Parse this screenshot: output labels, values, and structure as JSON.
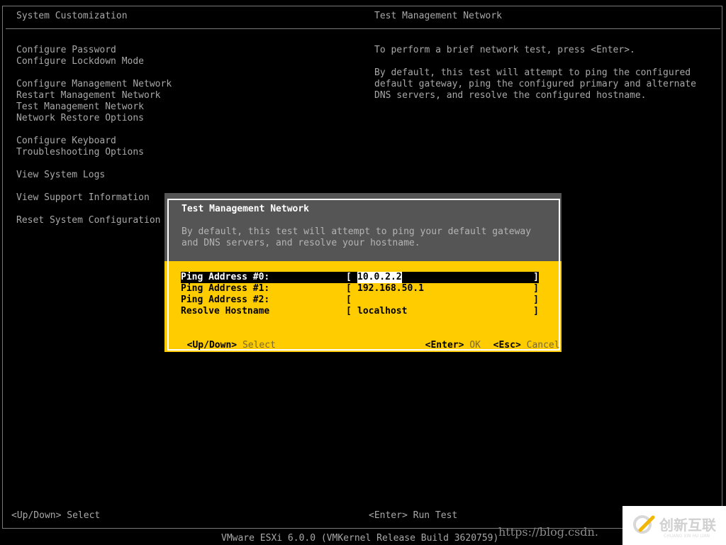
{
  "left_panel": {
    "title": "System Customization",
    "menu_groups": [
      [
        "Configure Password",
        "Configure Lockdown Mode"
      ],
      [
        "Configure Management Network",
        "Restart Management Network",
        "Test Management Network",
        "Network Restore Options"
      ],
      [
        "Configure Keyboard",
        "Troubleshooting Options"
      ],
      [
        "View System Logs"
      ],
      [
        "View Support Information"
      ],
      [
        "Reset System Configuration"
      ]
    ]
  },
  "right_panel": {
    "title": "Test Management Network",
    "lines": [
      "To perform a brief network test, press <Enter>.",
      "",
      "By default, this test will attempt to ping the configured",
      "default gateway, ping the configured primary and alternate",
      "DNS servers, and resolve the configured hostname."
    ]
  },
  "dialog": {
    "title": "Test Management Network",
    "description": [
      "By default, this test will attempt to ping your default gateway",
      "and DNS servers, and resolve your hostname."
    ],
    "fields": [
      {
        "label": "Ping Address #0:",
        "value": "10.0.2.2",
        "selected": true
      },
      {
        "label": "Ping Address #1:",
        "value": "192.168.50.1",
        "selected": false
      },
      {
        "label": "Ping Address #2:",
        "value": "",
        "selected": false
      },
      {
        "label": "Resolve Hostname",
        "value": "localhost",
        "selected": false
      }
    ],
    "bracket_open": "[",
    "bracket_close": "]",
    "hints": {
      "select_key": "<Up/Down>",
      "select_action": "Select",
      "ok_key": "<Enter>",
      "ok_action": "OK",
      "cancel_key": "<Esc>",
      "cancel_action": "Cancel"
    },
    "colors": {
      "header_bg": "#555555",
      "body_bg": "#ffcc00",
      "border": "#ffffff"
    }
  },
  "footer": {
    "left_hint": "<Up/Down> Select",
    "right_hint": "<Enter> Run Test",
    "version": "VMware ESXi 6.0.0 (VMKernel Release Build 3620759)"
  },
  "watermark": {
    "url": "https://blog.csdn.",
    "brand_cn": "创新互联",
    "brand_en": "CHUANG XIN HU LIAN"
  }
}
